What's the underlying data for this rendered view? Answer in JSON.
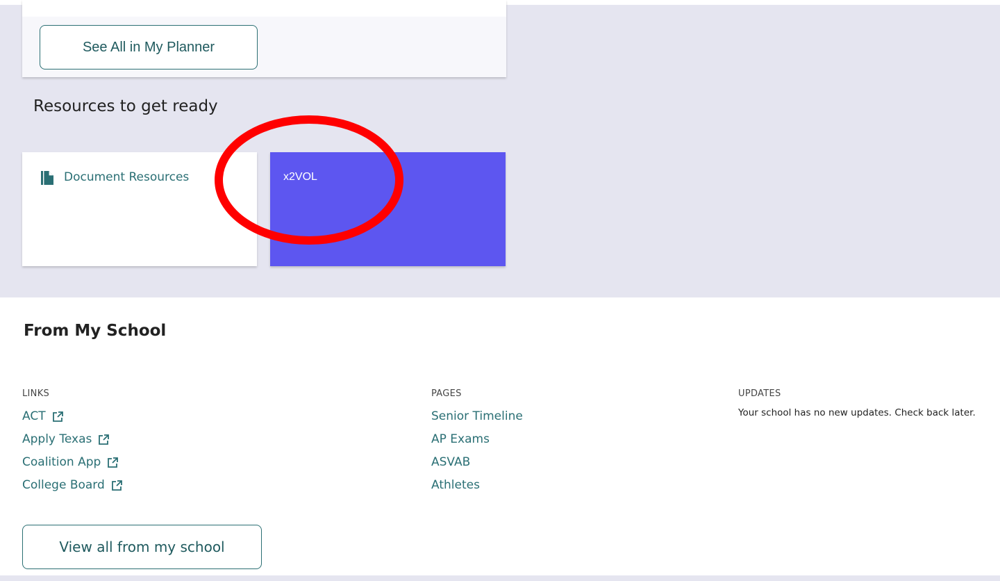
{
  "planner": {
    "button_label": "See All in My Planner"
  },
  "resources": {
    "title": "Resources to get ready",
    "cards": [
      {
        "label": "Document Resources",
        "icon": "document-icon",
        "color": "#ffffff"
      },
      {
        "label": "x2VOL",
        "color": "#5d56f0"
      }
    ]
  },
  "annotation": {
    "shape": "circle",
    "color": "#ff0000"
  },
  "school": {
    "title": "From My School",
    "links": {
      "heading": "LINKS",
      "items": [
        "ACT",
        "Apply Texas",
        "Coalition App",
        "College Board"
      ],
      "item_icon": "external-link-icon"
    },
    "pages": {
      "heading": "PAGES",
      "items": [
        "Senior Timeline",
        "AP Exams",
        "ASVAB",
        "Athletes"
      ]
    },
    "updates": {
      "heading": "UPDATES",
      "message": "Your school has no new updates. Check back later."
    },
    "view_all_label": "View all from my school"
  },
  "colors": {
    "background": "#e5e5f0",
    "accent_teal": "#2a6f74",
    "x2vol_card": "#5d56f0"
  }
}
